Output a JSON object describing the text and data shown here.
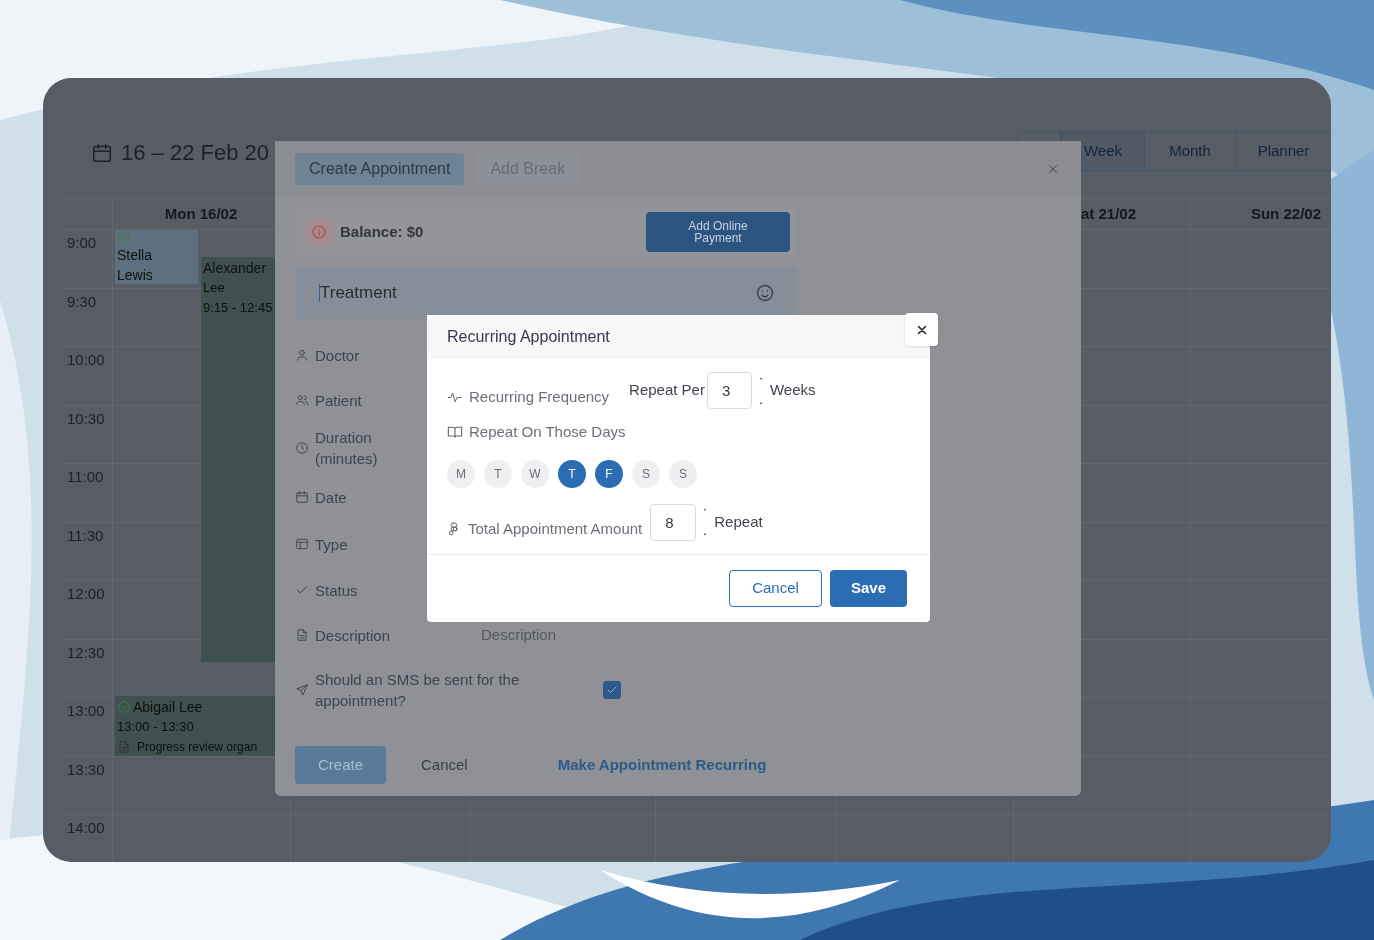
{
  "calendar": {
    "range_title": "16 – 22 Feb 20",
    "views": [
      {
        "label": "Week",
        "selected": true
      },
      {
        "label": "Month",
        "selected": false
      },
      {
        "label": "Planner",
        "selected": false
      }
    ],
    "day_headers": [
      "Mon 16/02",
      "at 21/02",
      "Sun 22/02"
    ],
    "times": [
      "9:00",
      "9:30",
      "10:00",
      "10:30",
      "11:00",
      "11:30",
      "12:00",
      "12:30",
      "13:00",
      "13:30",
      "14:00"
    ],
    "events": [
      {
        "lines": [
          "Stella",
          "Lewis"
        ],
        "checked": true,
        "color": "#5c7080"
      },
      {
        "lines": [
          "Alexander",
          "Lee",
          "9:15 - 12:45"
        ],
        "checked": false,
        "color": "#3f514e"
      },
      {
        "lines": [
          "Abigail Lee",
          "13:00 - 13:30",
          "Progress review organ"
        ],
        "checked": true,
        "color": "#3f514e"
      }
    ]
  },
  "appointment_modal": {
    "tabs": [
      {
        "label": "Create Appointment",
        "selected": true
      },
      {
        "label": "Add Break",
        "selected": false
      }
    ],
    "balance": "Balance: $0",
    "payment_button": "Add Online Payment",
    "treatment": {
      "placeholder": "Treatment"
    },
    "fields": [
      {
        "kind": "field",
        "label": "Doctor"
      },
      {
        "kind": "field",
        "label": "Patient"
      },
      {
        "kind": "field",
        "label": "Duration (minutes)"
      },
      {
        "kind": "field",
        "label": "Date"
      },
      {
        "kind": "field",
        "label": "Type"
      },
      {
        "kind": "field",
        "label": "Status"
      },
      {
        "kind": "text",
        "label": "Description",
        "placeholder": "Description"
      },
      {
        "kind": "checkbox",
        "label": "Should an SMS be sent for the appointment?",
        "checked": true
      }
    ],
    "buttons": [
      "Create",
      "Cancel"
    ],
    "recurring_link": "Make Appointment Recurring"
  },
  "recurring_dialog": {
    "title": "Recurring Appointment",
    "frequency": {
      "label": "Recurring Frequency",
      "prefix": "Repeat Per",
      "value": "3",
      "unit": "Weeks"
    },
    "days": {
      "label": "Repeat On Those Days",
      "items": [
        {
          "label": "M",
          "selected": false
        },
        {
          "label": "T",
          "selected": false
        },
        {
          "label": "W",
          "selected": false
        },
        {
          "label": "T",
          "selected": true
        },
        {
          "label": "F",
          "selected": true
        },
        {
          "label": "S",
          "selected": false
        },
        {
          "label": "S",
          "selected": false
        }
      ]
    },
    "total": {
      "label": "Total Appointment Amount",
      "value": "8",
      "unit": "Repeat"
    },
    "buttons": [
      "Cancel",
      "Save"
    ]
  }
}
